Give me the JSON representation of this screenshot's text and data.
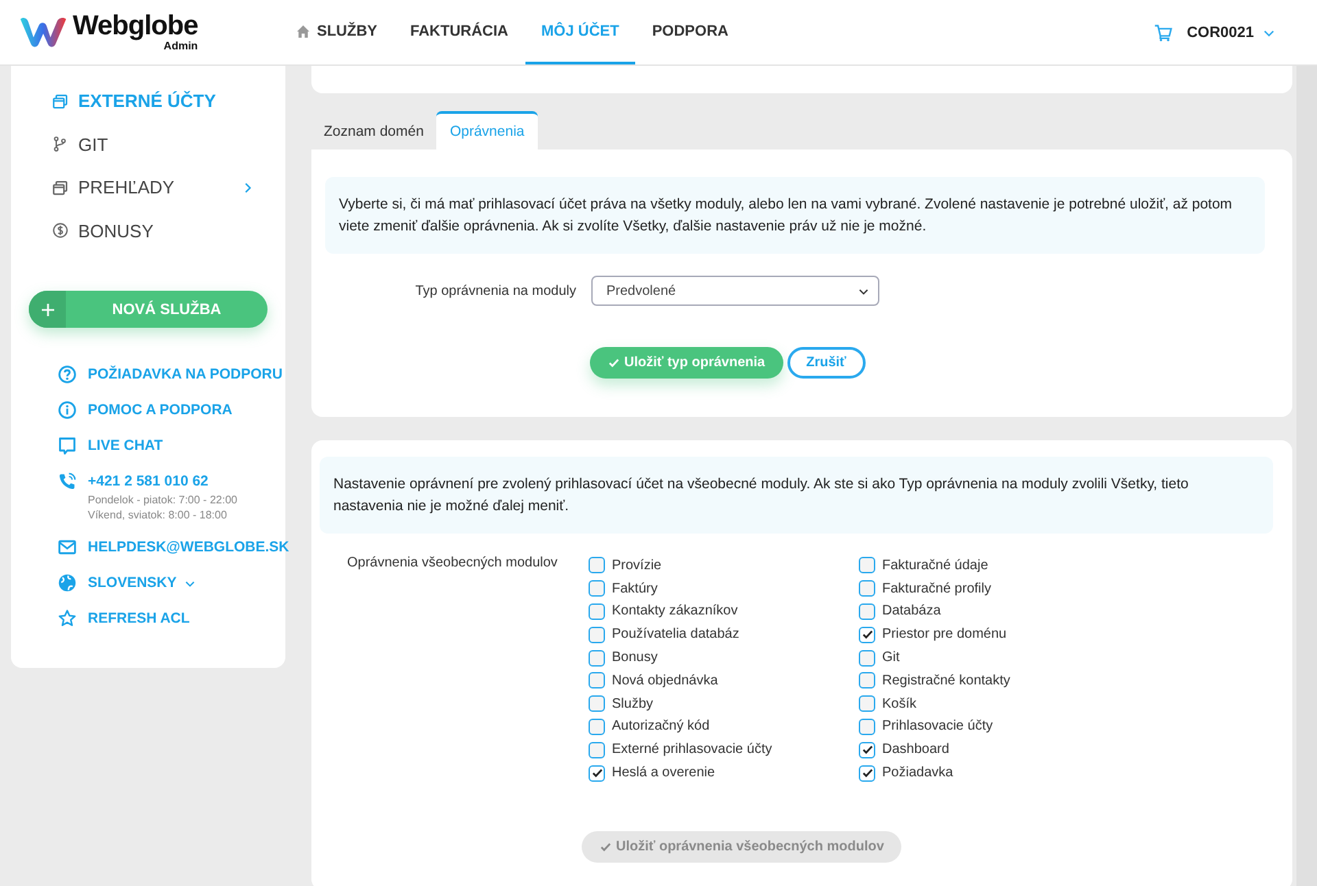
{
  "header": {
    "logo": "Webglobe",
    "logo_sub": "Admin",
    "nav": [
      {
        "label": "SLUŽBY",
        "selected": false
      },
      {
        "label": "FAKTURÁCIA",
        "selected": false
      },
      {
        "label": "MÔJ ÚČET",
        "selected": true
      },
      {
        "label": "PODPORA",
        "selected": false
      }
    ],
    "account": "COR0021"
  },
  "sidebar": {
    "items": [
      {
        "label": "EXTERNÉ ÚČTY",
        "selected": true
      },
      {
        "label": "GIT",
        "selected": false
      },
      {
        "label": "PREHĽADY",
        "selected": false,
        "has_children": true
      },
      {
        "label": "BONUSY",
        "selected": false
      }
    ],
    "new_button": "NOVÁ SLUŽBA",
    "links": [
      {
        "label": "POŽIADAVKA NA PODPORU"
      },
      {
        "label": "POMOC A PODPORA"
      },
      {
        "label": "LIVE CHAT"
      },
      {
        "label": "+421 2 581 010 62",
        "notes": [
          "Pondelok - piatok: 7:00 - 22:00",
          "Víkend, sviatok: 8:00 - 18:00"
        ]
      },
      {
        "label": "HELPDESK@WEBGLOBE.SK"
      },
      {
        "label": "SLOVENSKY",
        "dropdown": true
      },
      {
        "label": "REFRESH ACL"
      }
    ]
  },
  "tabs": [
    {
      "label": "Zoznam domén",
      "selected": false
    },
    {
      "label": "Oprávnenia",
      "selected": true
    }
  ],
  "type_card": {
    "info": "Vyberte si, či má mať prihlasovací účet práva na všetky moduly, alebo len na vami vybrané. Zvolené nastavenie je potrebné uložiť, až potom viete zmeniť ďalšie oprávnenia. Ak si zvolíte Všetky, ďalšie nastavenie práv už nie je možné.",
    "field_label": "Typ oprávnenia na moduly",
    "select_value": "Predvolené",
    "save_button": {
      "label": "Uložiť typ oprávnenia",
      "disabled": false
    },
    "cancel_button": "Zrušiť"
  },
  "modules_card": {
    "info": "Nastavenie oprávnení pre zvolený prihlasovací účet na všeobecné moduly. Ak ste si ako Typ oprávnenia na moduly zvolili Všetky, tieto nastavenia nie je možné ďalej meniť.",
    "field_label": "Oprávnenia všeobecných modulov",
    "columns": [
      [
        {
          "label": "Provízie",
          "checked": false
        },
        {
          "label": "Faktúry",
          "checked": false
        },
        {
          "label": "Kontakty zákazníkov",
          "checked": false
        },
        {
          "label": "Používatelia databáz",
          "checked": false
        },
        {
          "label": "Bonusy",
          "checked": false
        },
        {
          "label": "Nová objednávka",
          "checked": false
        },
        {
          "label": "Služby",
          "checked": false
        },
        {
          "label": "Autorizačný kód",
          "checked": false
        },
        {
          "label": "Externé prihlasovacie účty",
          "checked": false
        },
        {
          "label": "Heslá a overenie",
          "checked": true
        }
      ],
      [
        {
          "label": "Fakturačné údaje",
          "checked": false
        },
        {
          "label": "Fakturačné profily",
          "checked": false
        },
        {
          "label": "Databáza",
          "checked": false
        },
        {
          "label": "Priestor pre doménu",
          "checked": true
        },
        {
          "label": "Git",
          "checked": false
        },
        {
          "label": "Registračné kontakty",
          "checked": false
        },
        {
          "label": "Košík",
          "checked": false
        },
        {
          "label": "Prihlasovacie účty",
          "checked": false
        },
        {
          "label": "Dashboard",
          "checked": true
        },
        {
          "label": "Požiadavka",
          "checked": true
        }
      ]
    ],
    "save_button": {
      "label": "Uložiť oprávnenia všeobecných modulov",
      "disabled": true
    }
  }
}
